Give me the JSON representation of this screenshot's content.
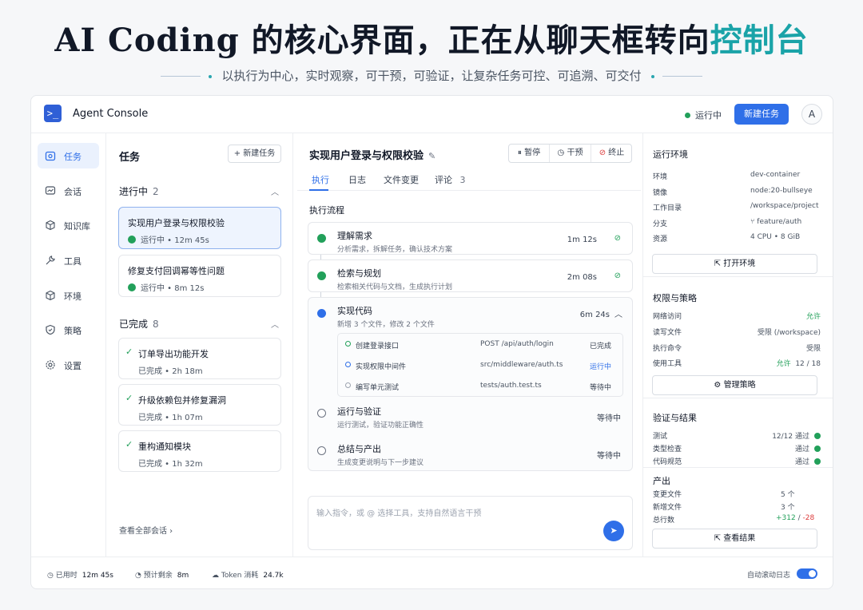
{
  "hero": {
    "title_main": "AI Coding 的核心界面，正在从聊天框转向",
    "title_accent": "控制台",
    "subtitle": "以执行为中心，实时观察，可干预，可验证，让复杂任务可控、可追溯、可交付"
  },
  "app": {
    "title": "Agent Console",
    "status": "运行中",
    "new_task_btn": "新建任务",
    "avatar": "A"
  },
  "sidebar": {
    "items": [
      {
        "label": "任务",
        "icon": "task-icon"
      },
      {
        "label": "会话",
        "icon": "chat-icon"
      },
      {
        "label": "知识库",
        "icon": "cube-icon"
      },
      {
        "label": "工具",
        "icon": "tool-icon"
      },
      {
        "label": "环境",
        "icon": "environment-icon"
      },
      {
        "label": "策略",
        "icon": "shield-icon"
      },
      {
        "label": "设置",
        "icon": "gear-icon"
      }
    ]
  },
  "tasklist": {
    "title": "任务",
    "new_btn": "+  新建任务",
    "running": {
      "label": "进行中",
      "count": "2",
      "items": [
        {
          "title": "实现用户登录与权限校验",
          "meta": "运行中  •  12m 45s"
        },
        {
          "title": "修复支付回调幂等性问题",
          "meta": "运行中  •  8m 12s"
        }
      ]
    },
    "done": {
      "label": "已完成",
      "count": "8",
      "items": [
        {
          "title": "订单导出功能开发",
          "meta": "已完成  •  2h 18m"
        },
        {
          "title": "升级依赖包并修复漏洞",
          "meta": "已完成  •  1h 07m"
        },
        {
          "title": "重构通知模块",
          "meta": "已完成  •  1h 32m"
        }
      ]
    },
    "view_all": "查看全部会话  ›"
  },
  "main": {
    "title": "实现用户登录与权限校验",
    "controls": {
      "pause": "暂停",
      "intervene": "干预",
      "stop": "终止"
    },
    "tabs": {
      "exec": "执行",
      "log": "日志",
      "files": "文件变更",
      "comments": "评论",
      "comments_count": "3"
    },
    "flow_title": "执行流程",
    "steps": [
      {
        "name": "理解需求",
        "desc": "分析需求，拆解任务，确认技术方案",
        "time": "1m 12s"
      },
      {
        "name": "检索与规划",
        "desc": "检索相关代码与文档，生成执行计划",
        "time": "2m 08s"
      },
      {
        "name": "实现代码",
        "desc": "新增 3 个文件，修改 2 个文件",
        "time": "6m 24s"
      },
      {
        "name": "运行与验证",
        "desc": "运行测试，验证功能正确性",
        "time": "等待中"
      },
      {
        "name": "总结与产出",
        "desc": "生成变更说明与下一步建议",
        "time": "等待中"
      }
    ],
    "substeps": [
      {
        "name": "创建登录接口",
        "path": "POST /api/auth/login",
        "status": "已完成"
      },
      {
        "name": "实现权限中间件",
        "path": "src/middleware/auth.ts",
        "status": "运行中"
      },
      {
        "name": "编写单元测试",
        "path": "tests/auth.test.ts",
        "status": "等待中"
      }
    ],
    "input_placeholder": "输入指令，或 @ 选择工具，支持自然语言干预"
  },
  "right": {
    "env": {
      "title": "运行环境",
      "rows": [
        {
          "k": "环境",
          "v": "dev-container"
        },
        {
          "k": "镜像",
          "v": "node:20-bullseye"
        },
        {
          "k": "工作目录",
          "v": "/workspace/project"
        },
        {
          "k": "分支",
          "v": "feature/auth"
        },
        {
          "k": "资源",
          "v": "4 CPU  •  8 GiB"
        }
      ],
      "btn": "打开环境"
    },
    "policy": {
      "title": "权限与策略",
      "rows": [
        {
          "k": "网络访问",
          "v": "允许"
        },
        {
          "k": "读写文件",
          "v": "受限 (/workspace)"
        },
        {
          "k": "执行命令",
          "v": "受限"
        },
        {
          "k": "使用工具",
          "v_green": "允许",
          "v": "12 / 18"
        }
      ],
      "btn": "管理策略"
    },
    "verify": {
      "title": "验证与结果",
      "rows": [
        {
          "k": "测试",
          "v": "12/12 通过"
        },
        {
          "k": "类型检查",
          "v": "通过"
        },
        {
          "k": "代码规范",
          "v": "通过"
        }
      ]
    },
    "output": {
      "title": "产出",
      "rows": [
        {
          "k": "变更文件",
          "v": "5 个"
        },
        {
          "k": "新增文件",
          "v": "3 个"
        },
        {
          "k": "总行数",
          "plus": "+312",
          "slash": " / ",
          "minus": "-28"
        }
      ],
      "btn": "查看结果"
    }
  },
  "bottom": {
    "used_label": "已用时",
    "used": "12m 45s",
    "remain_label": "预计剩余",
    "remain": "8m",
    "token_label": "Token 消耗",
    "token": "24.7k",
    "autoscroll": "自动滚动日志"
  },
  "colors": {
    "accent": "#2f6fe8",
    "success": "#22a05a",
    "danger": "#dc3b3b",
    "hero_accent": "#1aa3a8"
  }
}
